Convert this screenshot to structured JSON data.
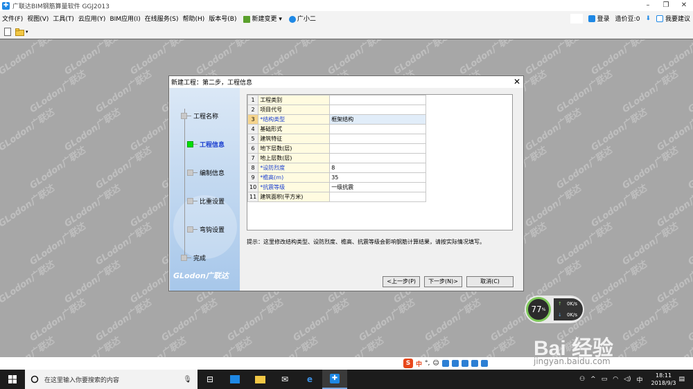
{
  "window": {
    "title": "广联达BIM钢筋算量软件 GGJ2013",
    "controls": [
      "–",
      "❐",
      "✕"
    ]
  },
  "menu": {
    "items": [
      "文件(F)",
      "视图(V)",
      "工具(T)",
      "云应用(Y)",
      "BIM应用(I)",
      "在线服务(S)",
      "帮助(H)",
      "版本号(B)"
    ],
    "new_change": "新建变更",
    "assistant": "广小二",
    "login": "登录",
    "price_beans": "造价豆:0",
    "feedback": "我要建议"
  },
  "watermark": "GLodon广联达",
  "dialog": {
    "title": "新建工程：第二步，工程信息",
    "close": "✕",
    "steps": [
      "工程名称",
      "工程信息",
      "编制信息",
      "比重设置",
      "弯钩设置",
      "完成"
    ],
    "active_step": "工程信息",
    "logo": "GLodon广联达",
    "rows": [
      {
        "n": "1",
        "name": "工程类别",
        "value": ""
      },
      {
        "n": "2",
        "name": "项目代号",
        "value": ""
      },
      {
        "n": "3",
        "name": "*结构类型",
        "value": "框架结构"
      },
      {
        "n": "4",
        "name": "基础形式",
        "value": ""
      },
      {
        "n": "5",
        "name": "建筑特征",
        "value": ""
      },
      {
        "n": "6",
        "name": "地下层数(层)",
        "value": ""
      },
      {
        "n": "7",
        "name": "地上层数(层)",
        "value": ""
      },
      {
        "n": "8",
        "name": "*设防烈度",
        "value": "8"
      },
      {
        "n": "9",
        "name": "*檐高(m)",
        "value": "35"
      },
      {
        "n": "10",
        "name": "*抗震等级",
        "value": "一级抗震"
      },
      {
        "n": "11",
        "name": "建筑面积(平方米)",
        "value": ""
      }
    ],
    "hint": "提示：这里修改结构类型、设防烈度、檐高、抗震等级会影响钢筋计算结果，请按实际情况填写。",
    "buttons": {
      "prev": "<上一步(P)",
      "next": "下一步(N)>",
      "cancel": "取消(C)"
    }
  },
  "speed_widget": {
    "percent": "77",
    "unit": "%",
    "up": "0K/s",
    "down": "0K/s"
  },
  "baidu": {
    "logo": "Bai 经验",
    "url": "jingyan.baidu.com"
  },
  "ime": {
    "s": "S",
    "lang": "中"
  },
  "taskbar": {
    "search_placeholder": "在这里输入你要搜索的内容",
    "time": "18:11",
    "date": "2018/9/3"
  },
  "colors": {
    "workspace": "#a7a7a7",
    "active_step": "#00e000",
    "required_label": "#1a3fd0"
  }
}
